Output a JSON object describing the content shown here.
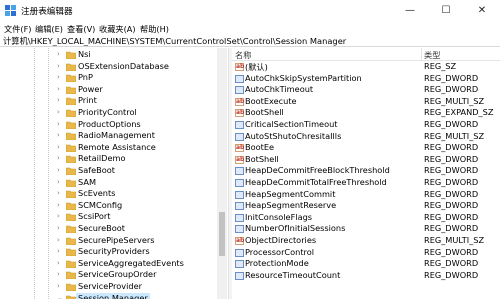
{
  "window": {
    "title": "注册表编辑器",
    "minimize": "—",
    "maximize": "☐",
    "close": "✕"
  },
  "menu": [
    "文件(F)",
    "编辑(E)",
    "查看(V)",
    "收藏夹(A)",
    "帮助(H)"
  ],
  "address": "计算机\\HKEY_LOCAL_MACHINE\\SYSTEM\\CurrentControlSet\\Control\\Session Manager",
  "tree": {
    "items": [
      {
        "label": "Nsi",
        "expanded": false
      },
      {
        "label": "OSExtensionDatabase",
        "expanded": false
      },
      {
        "label": "PnP",
        "expanded": false
      },
      {
        "label": "Power",
        "expanded": false
      },
      {
        "label": "Print",
        "expanded": false
      },
      {
        "label": "PriorityControl",
        "expanded": false
      },
      {
        "label": "ProductOptions",
        "expanded": false
      },
      {
        "label": "RadioManagement",
        "expanded": false
      },
      {
        "label": "Remote Assistance",
        "expanded": false
      },
      {
        "label": "RetailDemo",
        "expanded": false
      },
      {
        "label": "SafeBoot",
        "expanded": false
      },
      {
        "label": "SAM",
        "expanded": false
      },
      {
        "label": "ScEvents",
        "expanded": false
      },
      {
        "label": "SCMConfig",
        "expanded": false
      },
      {
        "label": "ScsiPort",
        "expanded": false
      },
      {
        "label": "SecureBoot",
        "expanded": false
      },
      {
        "label": "SecurePipeServers",
        "expanded": false
      },
      {
        "label": "SecurityProviders",
        "expanded": false
      },
      {
        "label": "ServiceAggregatedEvents",
        "expanded": false
      },
      {
        "label": "ServiceGroupOrder",
        "expanded": false
      },
      {
        "label": "ServiceProvider",
        "expanded": false
      },
      {
        "label": "Session Manager",
        "expanded": true,
        "selected": true
      }
    ]
  },
  "values": {
    "headers": {
      "name": "名称",
      "type": "类型"
    },
    "rows": [
      {
        "name": "(默认)",
        "type": "REG_SZ",
        "kind": "ab"
      },
      {
        "name": "AutoChkSkipSystemPartition",
        "type": "REG_DWORD",
        "kind": "bin"
      },
      {
        "name": "AutoChkTimeout",
        "type": "REG_DWORD",
        "kind": "bin"
      },
      {
        "name": "BootExecute",
        "type": "REG_MULTI_SZ",
        "kind": "ab"
      },
      {
        "name": "BootShell",
        "type": "REG_EXPAND_SZ",
        "kind": "ab"
      },
      {
        "name": "CriticalSectionTimeout",
        "type": "REG_DWORD",
        "kind": "bin"
      },
      {
        "name": "AutoStShutoChresitaIlls",
        "type": "REG_MULTI_SZ",
        "kind": "bin"
      },
      {
        "name": "BootEe",
        "type": "REG_DWORD",
        "kind": "ab"
      },
      {
        "name": "BotShell",
        "type": "REG_DWORD",
        "kind": "ab"
      },
      {
        "name": "HeapDeCommitFreeBlockThreshold",
        "type": "REG_DWORD",
        "kind": "bin"
      },
      {
        "name": "HeapDeCommitTotalFreeThreshold",
        "type": "REG_DWORD",
        "kind": "bin"
      },
      {
        "name": "HeapSegmentCommit",
        "type": "REG_DWORD",
        "kind": "bin"
      },
      {
        "name": "HeapSegmentReserve",
        "type": "REG_DWORD",
        "kind": "bin"
      },
      {
        "name": "InitConsoleFlags",
        "type": "REG_DWORD",
        "kind": "bin"
      },
      {
        "name": "NumberOfInitialSessions",
        "type": "REG_DWORD",
        "kind": "bin"
      },
      {
        "name": "ObjectDirectories",
        "type": "REG_MULTI_SZ",
        "kind": "ab"
      },
      {
        "name": "ProcessorControl",
        "type": "REG_DWORD",
        "kind": "bin"
      },
      {
        "name": "ProtectionMode",
        "type": "REG_DWORD",
        "kind": "bin"
      },
      {
        "name": "ResourceTimeoutCount",
        "type": "REG_DWORD",
        "kind": "bin"
      }
    ]
  }
}
